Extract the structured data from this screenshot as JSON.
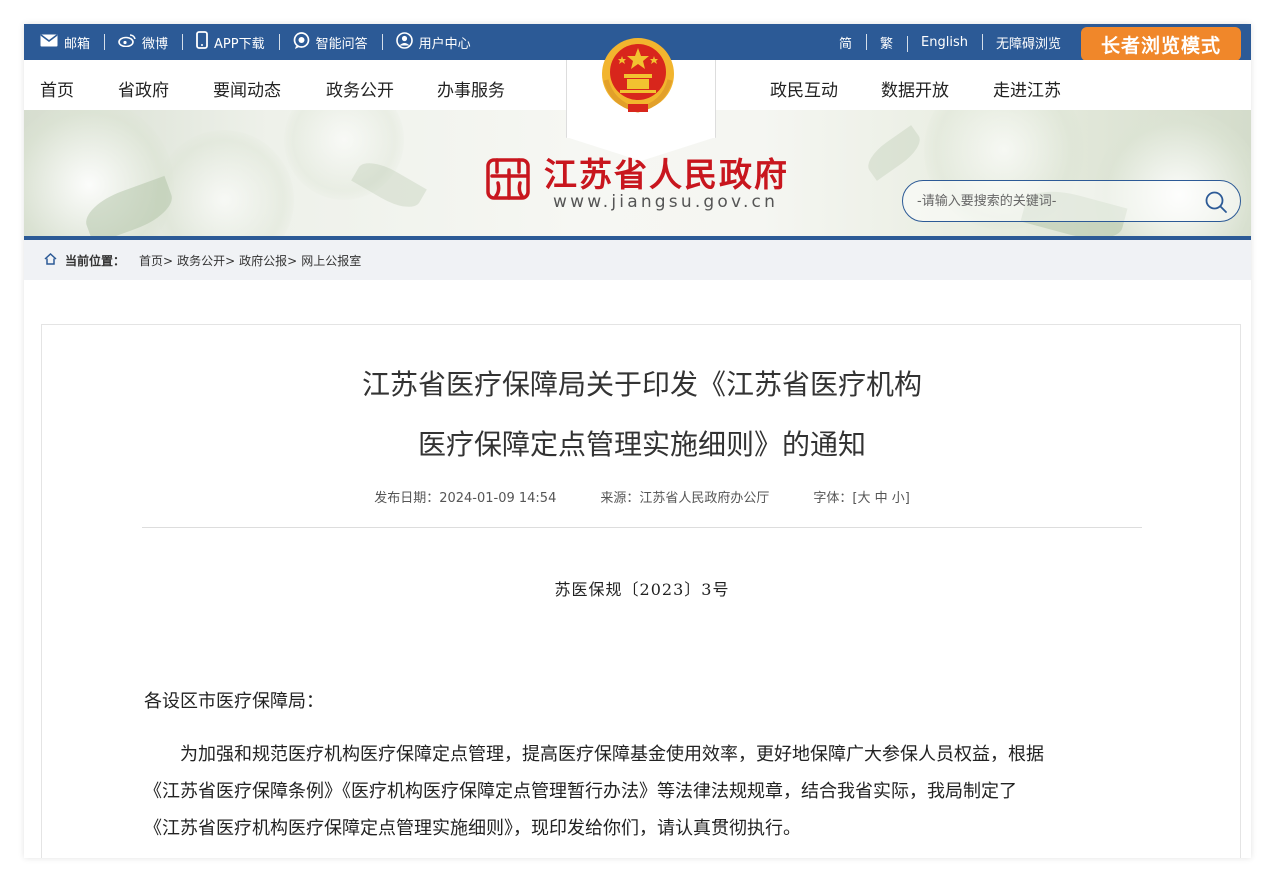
{
  "topbar": {
    "left_links": [
      {
        "icon": "mail-icon",
        "label": "邮箱"
      },
      {
        "icon": "weibo-icon",
        "label": "微博"
      },
      {
        "icon": "phone-icon",
        "label": "APP下载"
      },
      {
        "icon": "chat-icon",
        "label": "智能问答"
      },
      {
        "icon": "user-icon",
        "label": "用户中心"
      }
    ],
    "right_links": [
      "简",
      "繁",
      "English",
      "无障碍浏览"
    ],
    "elder_mode": "长者浏览模式"
  },
  "nav": {
    "left": [
      "首页",
      "省政府",
      "要闻动态",
      "政务公开",
      "办事服务"
    ],
    "right": [
      "政民互动",
      "数据开放",
      "走进江苏"
    ]
  },
  "banner": {
    "site_name": "江苏省人民政府",
    "site_url": "www.jiangsu.gov.cn",
    "search_placeholder": "-请输入要搜索的关键词-"
  },
  "breadcrumb": {
    "label": "当前位置：",
    "items": [
      "首页>",
      "政务公开>",
      "政府公报>",
      "网上公报室"
    ]
  },
  "article": {
    "title_line1": "江苏省医疗保障局关于印发《江苏省医疗机构",
    "title_line2": "医疗保障定点管理实施细则》的通知",
    "publish_date": "发布日期：2024-01-09 14:54",
    "source": "来源：江苏省人民政府办公厅",
    "font_size": "字体：[大 中 小]",
    "doc_number": "苏医保规〔2023〕3号",
    "addressee": "各设区市医疗保障局：",
    "paragraph_lines": [
      "　　为加强和规范医疗机构医疗保障定点管理，提高医疗保障基金使用效率，更好地保障广大参保人员权益，根据",
      "《江苏省医疗保障条例》《医疗机构医疗保障定点管理暂行办法》等法律法规规章，结合我省实际，我局制定了",
      "《江苏省医疗机构医疗保障定点管理实施细则》，现印发给你们，请认真贯彻执行。"
    ]
  },
  "colors": {
    "primary": "#2c5a96",
    "accent": "#f0872a",
    "brand_red": "#c8161e"
  }
}
